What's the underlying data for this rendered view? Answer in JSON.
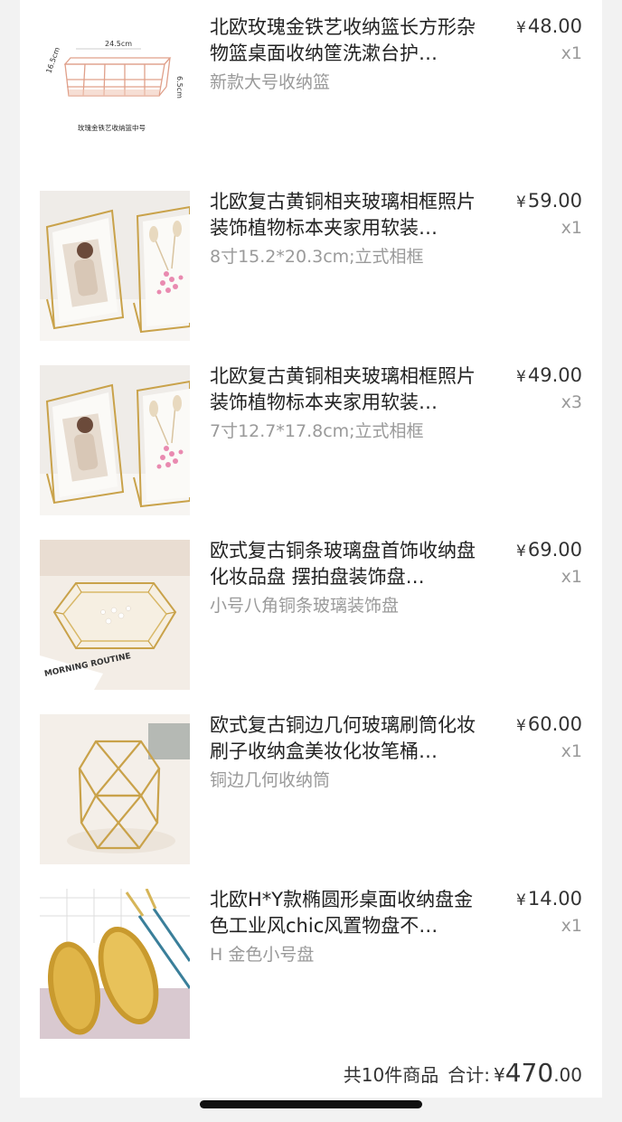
{
  "items": [
    {
      "title": "北欧玫瑰金铁艺收纳篮长方形杂物篮桌面收纳筐洗漱台护…",
      "spec": "新款大号收纳篮",
      "currency": "¥",
      "price": "48.00",
      "qty": "x1",
      "image_icon": "rose-gold-wire-basket-image",
      "image_label": "玫瑰金铁艺收纳篮中号",
      "image_dims": [
        "24.5cm",
        "16.5cm",
        "6.5cm"
      ]
    },
    {
      "title": "北欧复古黄铜相夹玻璃相框照片装饰植物标本夹家用软装…",
      "spec": "8寸15.2*20.3cm;立式相框",
      "currency": "¥",
      "price": "59.00",
      "qty": "x1",
      "image_icon": "brass-photo-frame-image"
    },
    {
      "title": "北欧复古黄铜相夹玻璃相框照片装饰植物标本夹家用软装…",
      "spec": "7寸12.7*17.8cm;立式相框",
      "currency": "¥",
      "price": "49.00",
      "qty": "x3",
      "image_icon": "brass-photo-frame-image"
    },
    {
      "title": "欧式复古铜条玻璃盘首饰收纳盘 化妆品盘 摆拍盘装饰盘…",
      "spec": "小号八角铜条玻璃装饰盘",
      "currency": "¥",
      "price": "69.00",
      "qty": "x1",
      "image_icon": "octagon-glass-tray-image",
      "image_label": "MORNING ROUTINE"
    },
    {
      "title": "欧式复古铜边几何玻璃刷筒化妆刷子收纳盒美妆化妆笔桶…",
      "spec": "铜边几何收纳筒",
      "currency": "¥",
      "price": "60.00",
      "qty": "x1",
      "image_icon": "geometric-brush-holder-image"
    },
    {
      "title": "北欧H*Y款椭圆形桌面收纳盘金色工业风chic风置物盘不…",
      "spec": "H 金色小号盘",
      "currency": "¥",
      "price": "14.00",
      "qty": "x1",
      "image_icon": "gold-oval-tray-image"
    }
  ],
  "summary": {
    "count_text": "共10件商品",
    "total_label": "合计:",
    "currency": "¥",
    "total_int": "470",
    "total_dec": ".00"
  },
  "colors": {
    "background": "#f2f2f2",
    "card": "#ffffff",
    "text": "#222222",
    "muted": "#9a9a9a",
    "gold": "#c9a24a",
    "rose_gold": "#e0a08a"
  }
}
